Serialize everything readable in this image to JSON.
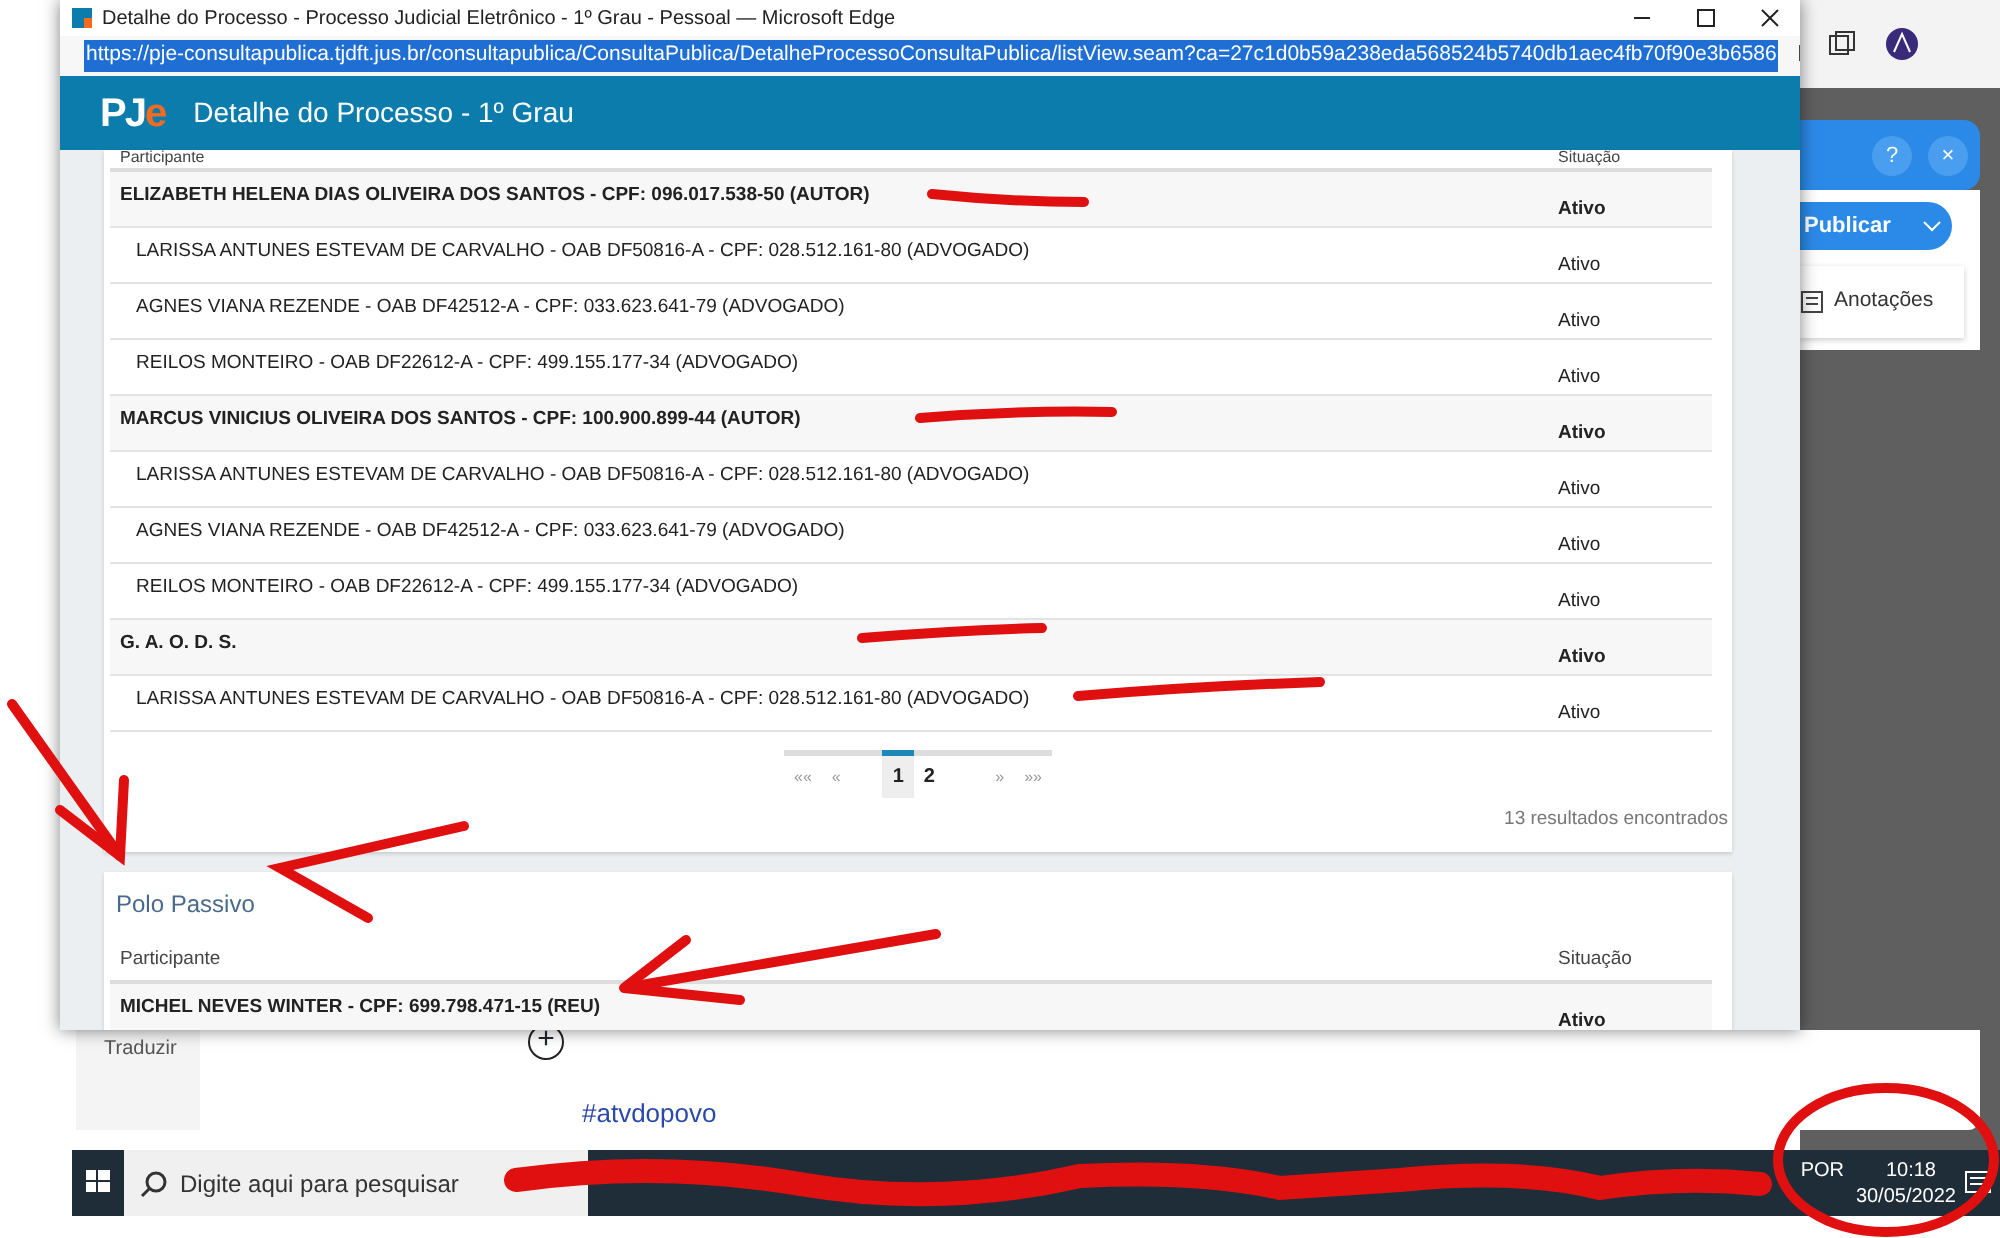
{
  "window": {
    "title": "Detalhe do Processo - Processo Judicial Eletrônico - 1º Grau - Pessoal — Microsoft Edge",
    "url": "https://pje-consultapublica.tjdft.jus.br/consultapublica/ConsultaPublica/DetalheProcessoConsultaPublica/listView.seam?ca=27c1d0b59a238eda568524b5740db1aec4fb70f90e3b6586"
  },
  "header": {
    "logo_main": "PJ",
    "logo_accent": "e",
    "title": "Detalhe do Processo - 1º Grau"
  },
  "polo_ativo": {
    "columns": [
      "Participante",
      "Situação"
    ],
    "rows": [
      {
        "kind": "party",
        "participant": "ELIZABETH HELENA DIAS OLIVEIRA DOS SANTOS - CPF: 096.017.538-50 (AUTOR)",
        "status": "Ativo"
      },
      {
        "kind": "lawyer",
        "participant": "LARISSA ANTUNES ESTEVAM DE CARVALHO - OAB DF50816-A - CPF: 028.512.161-80 (ADVOGADO)",
        "status": "Ativo"
      },
      {
        "kind": "lawyer",
        "participant": "AGNES VIANA REZENDE - OAB DF42512-A - CPF: 033.623.641-79 (ADVOGADO)",
        "status": "Ativo"
      },
      {
        "kind": "lawyer",
        "participant": "REILOS MONTEIRO - OAB DF22612-A - CPF: 499.155.177-34 (ADVOGADO)",
        "status": "Ativo"
      },
      {
        "kind": "party",
        "participant": "MARCUS VINICIUS OLIVEIRA DOS SANTOS - CPF: 100.900.899-44 (AUTOR)",
        "status": "Ativo"
      },
      {
        "kind": "lawyer",
        "participant": "LARISSA ANTUNES ESTEVAM DE CARVALHO - OAB DF50816-A - CPF: 028.512.161-80 (ADVOGADO)",
        "status": "Ativo"
      },
      {
        "kind": "lawyer",
        "participant": "AGNES VIANA REZENDE - OAB DF42512-A - CPF: 033.623.641-79 (ADVOGADO)",
        "status": "Ativo"
      },
      {
        "kind": "lawyer",
        "participant": "REILOS MONTEIRO - OAB DF22612-A - CPF: 499.155.177-34 (ADVOGADO)",
        "status": "Ativo"
      },
      {
        "kind": "party",
        "participant": "G. A. O. D. S.",
        "status": "Ativo"
      },
      {
        "kind": "lawyer",
        "participant": "LARISSA ANTUNES ESTEVAM DE CARVALHO - OAB DF50816-A - CPF: 028.512.161-80 (ADVOGADO)",
        "status": "Ativo"
      }
    ],
    "pagination": {
      "first": "««",
      "prev": "«",
      "pages": [
        {
          "label": "1",
          "selected": true
        },
        {
          "label": "2",
          "selected": false
        }
      ],
      "next": "»",
      "last": "»»"
    },
    "results": "13 resultados encontrados"
  },
  "polo_passivo": {
    "title": "Polo Passivo",
    "columns": [
      "Participante",
      "Situação"
    ],
    "rows": [
      {
        "kind": "party",
        "participant": "MICHEL NEVES WINTER - CPF: 699.798.471-15 (REU)",
        "status": "Ativo"
      }
    ]
  },
  "side_panel": {
    "help": "?",
    "close": "×",
    "publish": "Publicar",
    "notes": "Anotações"
  },
  "background_page": {
    "translate": "Traduzir",
    "add": "+",
    "hashtag": "#atvdopovo"
  },
  "taskbar": {
    "search_placeholder": "Digite aqui para pesquisar",
    "language": "POR",
    "time": "10:18",
    "date": "30/05/2022"
  }
}
